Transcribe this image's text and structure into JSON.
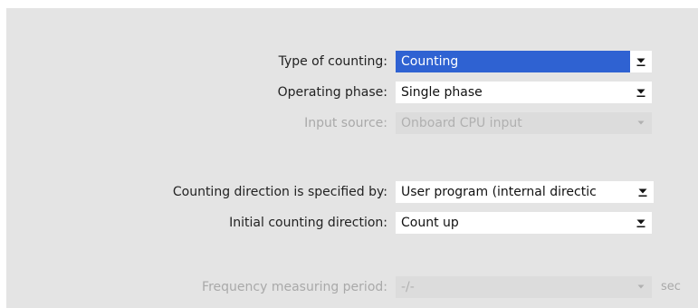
{
  "form": {
    "type_of_counting": {
      "label": "Type of counting:",
      "value": "Counting"
    },
    "operating_phase": {
      "label": "Operating phase:",
      "value": "Single phase"
    },
    "input_source": {
      "label": "Input source:",
      "value": "Onboard CPU input"
    },
    "counting_direction_specified_by": {
      "label": "Counting direction is specified by:",
      "value": "User program (internal directic"
    },
    "initial_counting_direction": {
      "label": "Initial counting direction:",
      "value": "Count up"
    },
    "frequency_measuring_period": {
      "label": "Frequency measuring period:",
      "value": "-/-",
      "unit": "sec"
    }
  },
  "colors": {
    "panel_background": "#e4e4e4",
    "selection_highlight": "#2f62d2",
    "disabled_text": "#a9a9a9"
  },
  "icons": {
    "dropdown": "chevron-down-icon"
  }
}
